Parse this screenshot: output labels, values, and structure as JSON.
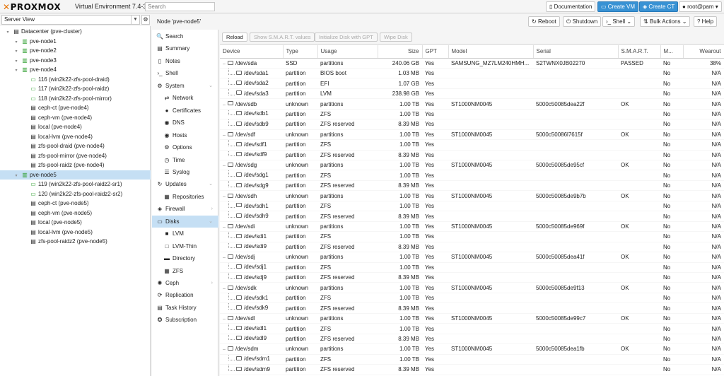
{
  "topbar": {
    "logo": "PROXMOX",
    "version": "Virtual Environment 7.4-3",
    "search_placeholder": "Search",
    "documentation": "Documentation",
    "create_vm": "Create VM",
    "create_ct": "Create CT",
    "user": "root@pam"
  },
  "view_selector": "Server View",
  "tree": [
    {
      "label": "Datacenter (pve-cluster)",
      "icon": "datacenter-icon",
      "indent": 0,
      "glyph": "▤"
    },
    {
      "label": "pve-node1",
      "icon": "node-icon",
      "indent": 1,
      "glyph": "▥"
    },
    {
      "label": "pve-node2",
      "icon": "node-icon",
      "indent": 1,
      "glyph": "▥"
    },
    {
      "label": "pve-node3",
      "icon": "node-icon",
      "indent": 1,
      "glyph": "▥"
    },
    {
      "label": "pve-node4",
      "icon": "node-icon",
      "indent": 1,
      "glyph": "▥"
    },
    {
      "label": "116 (win2k22-zfs-pool-draid)",
      "icon": "vm-icon",
      "indent": 2,
      "glyph": "▭"
    },
    {
      "label": "117 (win2k22-zfs-pool-raidz)",
      "icon": "vm-icon",
      "indent": 2,
      "glyph": "▭"
    },
    {
      "label": "118 (win2k22-zfs-pool-mirror)",
      "icon": "vm-icon",
      "indent": 2,
      "glyph": "▭"
    },
    {
      "label": "ceph-ct (pve-node4)",
      "icon": "storage-icon",
      "indent": 2,
      "glyph": "▤"
    },
    {
      "label": "ceph-vm (pve-node4)",
      "icon": "storage-icon",
      "indent": 2,
      "glyph": "▤"
    },
    {
      "label": "local (pve-node4)",
      "icon": "storage-icon",
      "indent": 2,
      "glyph": "▤"
    },
    {
      "label": "local-lvm (pve-node4)",
      "icon": "storage-icon",
      "indent": 2,
      "glyph": "▤"
    },
    {
      "label": "zfs-pool-draid (pve-node4)",
      "icon": "storage-icon",
      "indent": 2,
      "glyph": "▤"
    },
    {
      "label": "zfs-pool-mirror (pve-node4)",
      "icon": "storage-icon",
      "indent": 2,
      "glyph": "▤"
    },
    {
      "label": "zfs-pool-raidz (pve-node4)",
      "icon": "storage-icon",
      "indent": 2,
      "glyph": "▤"
    },
    {
      "label": "pve-node5",
      "icon": "node-icon",
      "indent": 1,
      "glyph": "▥",
      "selected": true
    },
    {
      "label": "119 (win2k22-zfs-pool-raidz2-sr1)",
      "icon": "vm-icon",
      "indent": 2,
      "glyph": "▭"
    },
    {
      "label": "120 (win2k22-zfs-pool-raidz2-sr2)",
      "icon": "vm-icon",
      "indent": 2,
      "glyph": "▭"
    },
    {
      "label": "ceph-ct (pve-node5)",
      "icon": "storage-icon",
      "indent": 2,
      "glyph": "▤"
    },
    {
      "label": "ceph-vm (pve-node5)",
      "icon": "storage-icon",
      "indent": 2,
      "glyph": "▤"
    },
    {
      "label": "local (pve-node5)",
      "icon": "storage-icon",
      "indent": 2,
      "glyph": "▤"
    },
    {
      "label": "local-lvm (pve-node5)",
      "icon": "storage-icon",
      "indent": 2,
      "glyph": "▤"
    },
    {
      "label": "zfs-pool-raidz2 (pve-node5)",
      "icon": "storage-icon",
      "indent": 2,
      "glyph": "▤"
    }
  ],
  "header": {
    "title": "Node 'pve-node5'",
    "reboot": "Reboot",
    "shutdown": "Shutdown",
    "shell": "Shell",
    "bulk_actions": "Bulk Actions",
    "help": "Help"
  },
  "nav": [
    {
      "label": "Search",
      "icon": "search-icon",
      "glyph": "🔍",
      "indent": 0
    },
    {
      "label": "Summary",
      "icon": "summary-icon",
      "glyph": "▤",
      "indent": 0
    },
    {
      "label": "Notes",
      "icon": "notes-icon",
      "glyph": "▯",
      "indent": 0
    },
    {
      "label": "Shell",
      "icon": "terminal-icon",
      "glyph": "›_",
      "indent": 0
    },
    {
      "label": "System",
      "icon": "gear-icon",
      "glyph": "⚙",
      "indent": 0,
      "expander": true
    },
    {
      "label": "Network",
      "icon": "network-icon",
      "glyph": "⇄",
      "indent": 1
    },
    {
      "label": "Certificates",
      "icon": "certificate-icon",
      "glyph": "●",
      "indent": 1
    },
    {
      "label": "DNS",
      "icon": "globe-icon",
      "glyph": "◉",
      "indent": 1
    },
    {
      "label": "Hosts",
      "icon": "globe-icon",
      "glyph": "◉",
      "indent": 1
    },
    {
      "label": "Options",
      "icon": "gear-icon",
      "glyph": "⚙",
      "indent": 1
    },
    {
      "label": "Time",
      "icon": "clock-icon",
      "glyph": "◷",
      "indent": 1
    },
    {
      "label": "Syslog",
      "icon": "list-icon",
      "glyph": "☰",
      "indent": 1
    },
    {
      "label": "Updates",
      "icon": "refresh-icon",
      "glyph": "↻",
      "indent": 0,
      "expander": true
    },
    {
      "label": "Repositories",
      "icon": "repository-icon",
      "glyph": "▦",
      "indent": 1
    },
    {
      "label": "Firewall",
      "icon": "shield-icon",
      "glyph": "◈",
      "indent": 0,
      "arrow": true
    },
    {
      "label": "Disks",
      "icon": "disk-icon",
      "glyph": "▭",
      "indent": 0,
      "selected": true,
      "expander": true
    },
    {
      "label": "LVM",
      "icon": "lvm-icon",
      "glyph": "■",
      "indent": 1
    },
    {
      "label": "LVM-Thin",
      "icon": "lvm-thin-icon",
      "glyph": "□",
      "indent": 1
    },
    {
      "label": "Directory",
      "icon": "folder-icon",
      "glyph": "▬",
      "indent": 1
    },
    {
      "label": "ZFS",
      "icon": "zfs-icon",
      "glyph": "▦",
      "indent": 1
    },
    {
      "label": "Ceph",
      "icon": "ceph-icon",
      "glyph": "✺",
      "indent": 0,
      "arrow": true
    },
    {
      "label": "Replication",
      "icon": "replication-icon",
      "glyph": "⟳",
      "indent": 0
    },
    {
      "label": "Task History",
      "icon": "task-history-icon",
      "glyph": "▤",
      "indent": 0
    },
    {
      "label": "Subscription",
      "icon": "subscription-icon",
      "glyph": "✪",
      "indent": 0
    }
  ],
  "toolbar": {
    "reload": "Reload",
    "smart": "Show S.M.A.R.T. values",
    "init_gpt": "Initialize Disk with GPT",
    "wipe": "Wipe Disk"
  },
  "columns": [
    "Device",
    "Type",
    "Usage",
    "Size",
    "GPT",
    "Model",
    "Serial",
    "S.M.A.R.T.",
    "M...",
    "Wearout"
  ],
  "rows": [
    {
      "device": "/dev/sda",
      "type": "SSD",
      "usage": "partitions",
      "size": "240.06 GB",
      "gpt": "Yes",
      "model": "SAMSUNG_MZ7LM240HMH...",
      "serial": "S2TWNX0JB02270",
      "smart": "PASSED",
      "mounted": "No",
      "wearout": "38%",
      "child": false
    },
    {
      "device": "/dev/sda1",
      "type": "partition",
      "usage": "BIOS boot",
      "size": "1.03 MB",
      "gpt": "Yes",
      "model": "",
      "serial": "",
      "smart": "",
      "mounted": "No",
      "wearout": "N/A",
      "child": true
    },
    {
      "device": "/dev/sda2",
      "type": "partition",
      "usage": "EFI",
      "size": "1.07 GB",
      "gpt": "Yes",
      "model": "",
      "serial": "",
      "smart": "",
      "mounted": "No",
      "wearout": "N/A",
      "child": true
    },
    {
      "device": "/dev/sda3",
      "type": "partition",
      "usage": "LVM",
      "size": "238.98 GB",
      "gpt": "Yes",
      "model": "",
      "serial": "",
      "smart": "",
      "mounted": "No",
      "wearout": "N/A",
      "child": true
    },
    {
      "device": "/dev/sdb",
      "type": "unknown",
      "usage": "partitions",
      "size": "1.00 TB",
      "gpt": "Yes",
      "model": "ST1000NM0045",
      "serial": "5000c50085dea22f",
      "smart": "OK",
      "mounted": "No",
      "wearout": "N/A",
      "child": false
    },
    {
      "device": "/dev/sdb1",
      "type": "partition",
      "usage": "ZFS",
      "size": "1.00 TB",
      "gpt": "Yes",
      "model": "",
      "serial": "",
      "smart": "",
      "mounted": "No",
      "wearout": "N/A",
      "child": true
    },
    {
      "device": "/dev/sdb9",
      "type": "partition",
      "usage": "ZFS reserved",
      "size": "8.39 MB",
      "gpt": "Yes",
      "model": "",
      "serial": "",
      "smart": "",
      "mounted": "No",
      "wearout": "N/A",
      "child": true
    },
    {
      "device": "/dev/sdf",
      "type": "unknown",
      "usage": "partitions",
      "size": "1.00 TB",
      "gpt": "Yes",
      "model": "ST1000NM0045",
      "serial": "5000c50086l7615f",
      "smart": "OK",
      "mounted": "No",
      "wearout": "N/A",
      "child": false
    },
    {
      "device": "/dev/sdf1",
      "type": "partition",
      "usage": "ZFS",
      "size": "1.00 TB",
      "gpt": "Yes",
      "model": "",
      "serial": "",
      "smart": "",
      "mounted": "No",
      "wearout": "N/A",
      "child": true
    },
    {
      "device": "/dev/sdf9",
      "type": "partition",
      "usage": "ZFS reserved",
      "size": "8.39 MB",
      "gpt": "Yes",
      "model": "",
      "serial": "",
      "smart": "",
      "mounted": "No",
      "wearout": "N/A",
      "child": true
    },
    {
      "device": "/dev/sdg",
      "type": "unknown",
      "usage": "partitions",
      "size": "1.00 TB",
      "gpt": "Yes",
      "model": "ST1000NM0045",
      "serial": "5000c50085de95cf",
      "smart": "OK",
      "mounted": "No",
      "wearout": "N/A",
      "child": false
    },
    {
      "device": "/dev/sdg1",
      "type": "partition",
      "usage": "ZFS",
      "size": "1.00 TB",
      "gpt": "Yes",
      "model": "",
      "serial": "",
      "smart": "",
      "mounted": "No",
      "wearout": "N/A",
      "child": true
    },
    {
      "device": "/dev/sdg9",
      "type": "partition",
      "usage": "ZFS reserved",
      "size": "8.39 MB",
      "gpt": "Yes",
      "model": "",
      "serial": "",
      "smart": "",
      "mounted": "No",
      "wearout": "N/A",
      "child": true
    },
    {
      "device": "/dev/sdh",
      "type": "unknown",
      "usage": "partitions",
      "size": "1.00 TB",
      "gpt": "Yes",
      "model": "ST1000NM0045",
      "serial": "5000c50085de9b7b",
      "smart": "OK",
      "mounted": "No",
      "wearout": "N/A",
      "child": false
    },
    {
      "device": "/dev/sdh1",
      "type": "partition",
      "usage": "ZFS",
      "size": "1.00 TB",
      "gpt": "Yes",
      "model": "",
      "serial": "",
      "smart": "",
      "mounted": "No",
      "wearout": "N/A",
      "child": true
    },
    {
      "device": "/dev/sdh9",
      "type": "partition",
      "usage": "ZFS reserved",
      "size": "8.39 MB",
      "gpt": "Yes",
      "model": "",
      "serial": "",
      "smart": "",
      "mounted": "No",
      "wearout": "N/A",
      "child": true
    },
    {
      "device": "/dev/sdi",
      "type": "unknown",
      "usage": "partitions",
      "size": "1.00 TB",
      "gpt": "Yes",
      "model": "ST1000NM0045",
      "serial": "5000c50085de969f",
      "smart": "OK",
      "mounted": "No",
      "wearout": "N/A",
      "child": false
    },
    {
      "device": "/dev/sdi1",
      "type": "partition",
      "usage": "ZFS",
      "size": "1.00 TB",
      "gpt": "Yes",
      "model": "",
      "serial": "",
      "smart": "",
      "mounted": "No",
      "wearout": "N/A",
      "child": true
    },
    {
      "device": "/dev/sdi9",
      "type": "partition",
      "usage": "ZFS reserved",
      "size": "8.39 MB",
      "gpt": "Yes",
      "model": "",
      "serial": "",
      "smart": "",
      "mounted": "No",
      "wearout": "N/A",
      "child": true
    },
    {
      "device": "/dev/sdj",
      "type": "unknown",
      "usage": "partitions",
      "size": "1.00 TB",
      "gpt": "Yes",
      "model": "ST1000NM0045",
      "serial": "5000c50085dea41f",
      "smart": "OK",
      "mounted": "No",
      "wearout": "N/A",
      "child": false
    },
    {
      "device": "/dev/sdj1",
      "type": "partition",
      "usage": "ZFS",
      "size": "1.00 TB",
      "gpt": "Yes",
      "model": "",
      "serial": "",
      "smart": "",
      "mounted": "No",
      "wearout": "N/A",
      "child": true
    },
    {
      "device": "/dev/sdj9",
      "type": "partition",
      "usage": "ZFS reserved",
      "size": "8.39 MB",
      "gpt": "Yes",
      "model": "",
      "serial": "",
      "smart": "",
      "mounted": "No",
      "wearout": "N/A",
      "child": true
    },
    {
      "device": "/dev/sdk",
      "type": "unknown",
      "usage": "partitions",
      "size": "1.00 TB",
      "gpt": "Yes",
      "model": "ST1000NM0045",
      "serial": "5000c50085de9f13",
      "smart": "OK",
      "mounted": "No",
      "wearout": "N/A",
      "child": false
    },
    {
      "device": "/dev/sdk1",
      "type": "partition",
      "usage": "ZFS",
      "size": "1.00 TB",
      "gpt": "Yes",
      "model": "",
      "serial": "",
      "smart": "",
      "mounted": "No",
      "wearout": "N/A",
      "child": true
    },
    {
      "device": "/dev/sdk9",
      "type": "partition",
      "usage": "ZFS reserved",
      "size": "8.39 MB",
      "gpt": "Yes",
      "model": "",
      "serial": "",
      "smart": "",
      "mounted": "No",
      "wearout": "N/A",
      "child": true
    },
    {
      "device": "/dev/sdl",
      "type": "unknown",
      "usage": "partitions",
      "size": "1.00 TB",
      "gpt": "Yes",
      "model": "ST1000NM0045",
      "serial": "5000c50085de99c7",
      "smart": "OK",
      "mounted": "No",
      "wearout": "N/A",
      "child": false
    },
    {
      "device": "/dev/sdl1",
      "type": "partition",
      "usage": "ZFS",
      "size": "1.00 TB",
      "gpt": "Yes",
      "model": "",
      "serial": "",
      "smart": "",
      "mounted": "No",
      "wearout": "N/A",
      "child": true
    },
    {
      "device": "/dev/sdl9",
      "type": "partition",
      "usage": "ZFS reserved",
      "size": "8.39 MB",
      "gpt": "Yes",
      "model": "",
      "serial": "",
      "smart": "",
      "mounted": "No",
      "wearout": "N/A",
      "child": true
    },
    {
      "device": "/dev/sdm",
      "type": "unknown",
      "usage": "partitions",
      "size": "1.00 TB",
      "gpt": "Yes",
      "model": "ST1000NM0045",
      "serial": "5000c50085dea1fb",
      "smart": "OK",
      "mounted": "No",
      "wearout": "N/A",
      "child": false
    },
    {
      "device": "/dev/sdm1",
      "type": "partition",
      "usage": "ZFS",
      "size": "1.00 TB",
      "gpt": "Yes",
      "model": "",
      "serial": "",
      "smart": "",
      "mounted": "No",
      "wearout": "N/A",
      "child": true
    },
    {
      "device": "/dev/sdm9",
      "type": "partition",
      "usage": "ZFS reserved",
      "size": "8.39 MB",
      "gpt": "Yes",
      "model": "",
      "serial": "",
      "smart": "",
      "mounted": "No",
      "wearout": "N/A",
      "child": true
    }
  ],
  "colors": {
    "accent": "#3892d4",
    "selection": "#c5dff4",
    "logo_x": "#e57000",
    "online": "#2e9e2e"
  }
}
